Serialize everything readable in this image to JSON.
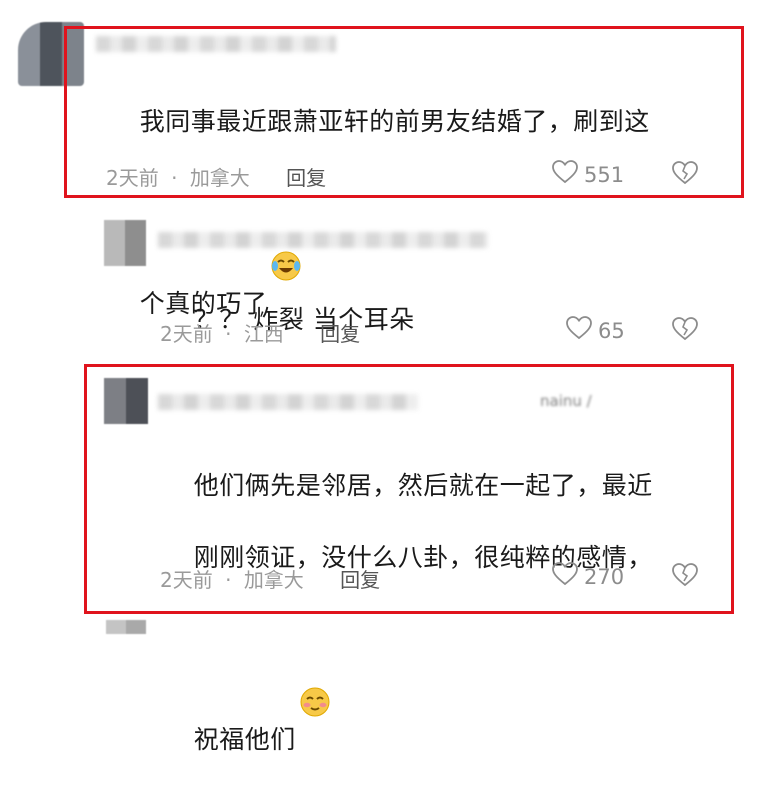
{
  "comments": [
    {
      "text_line1": "我同事最近跟萧亚轩的前男友结婚了，刷到这",
      "text_line2": "个真的巧了",
      "emoji": "laughing-crying-emoji",
      "time": "2天前",
      "location": "加拿大",
      "sep": "·",
      "reply_label": "回复",
      "likes": "551"
    },
    {
      "text_line1": "？？ 炸裂 当个耳朵",
      "time": "2天前",
      "location": "江西",
      "sep": "·",
      "reply_label": "回复",
      "likes": "65"
    },
    {
      "name_fragment": "nainu /",
      "text_line1": "他们俩先是邻居，然后就在一起了，最近",
      "text_line2": "刚刚领证，没什么八卦，很纯粹的感情，",
      "text_line3": "祝福他们",
      "emoji": "blushing-emoji",
      "time": "2天前",
      "location": "加拿大",
      "sep": "·",
      "reply_label": "回复",
      "likes": "270"
    }
  ],
  "colors": {
    "highlight": "#e0131d",
    "meta": "#9a9a9a",
    "text": "#1a1a1a"
  }
}
